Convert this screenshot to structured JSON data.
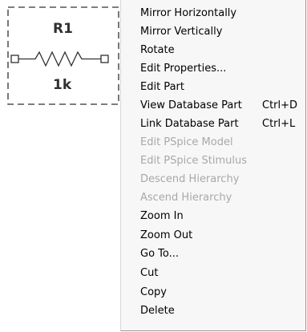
{
  "part": {
    "reference": "R1",
    "value": "1k"
  },
  "menu": {
    "items": [
      {
        "label": "Mirror Horizontally",
        "shortcut": "",
        "enabled": true
      },
      {
        "label": "Mirror Vertically",
        "shortcut": "",
        "enabled": true
      },
      {
        "label": "Rotate",
        "shortcut": "",
        "enabled": true
      },
      {
        "label": "Edit Properties...",
        "shortcut": "",
        "enabled": true
      },
      {
        "label": "Edit Part",
        "shortcut": "",
        "enabled": true
      },
      {
        "label": "View Database Part",
        "shortcut": "Ctrl+D",
        "enabled": true
      },
      {
        "label": "Link Database Part",
        "shortcut": "Ctrl+L",
        "enabled": true
      },
      {
        "label": "Edit PSpice Model",
        "shortcut": "",
        "enabled": false
      },
      {
        "label": "Edit PSpice Stimulus",
        "shortcut": "",
        "enabled": false
      },
      {
        "label": "Descend Hierarchy",
        "shortcut": "",
        "enabled": false
      },
      {
        "label": "Ascend Hierarchy",
        "shortcut": "",
        "enabled": false
      },
      {
        "label": "Zoom In",
        "shortcut": "",
        "enabled": true
      },
      {
        "label": "Zoom Out",
        "shortcut": "",
        "enabled": true
      },
      {
        "label": "Go To...",
        "shortcut": "",
        "enabled": true
      },
      {
        "label": "Cut",
        "shortcut": "",
        "enabled": true
      },
      {
        "label": "Copy",
        "shortcut": "",
        "enabled": true
      },
      {
        "label": "Delete",
        "shortcut": "",
        "enabled": true
      }
    ]
  },
  "colors": {
    "menu_background": "#f7f7f7",
    "disabled_text": "#a8a8a8",
    "part_outline": "#303030"
  }
}
